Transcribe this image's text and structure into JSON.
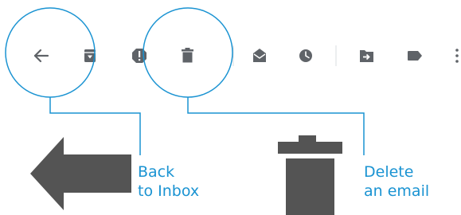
{
  "colors": {
    "icon": "#5f6368",
    "big_icon": "#545454",
    "accent": "#1a93d2",
    "divider": "#dadce0",
    "background": "#ffffff"
  },
  "toolbar": {
    "buttons": [
      {
        "name": "back-button",
        "icon": "arrow-left-icon"
      },
      {
        "name": "archive-button",
        "icon": "archive-icon"
      },
      {
        "name": "report-spam-button",
        "icon": "report-spam-icon"
      },
      {
        "name": "delete-button",
        "icon": "trash-icon"
      },
      {
        "name": "mark-as-unread-button",
        "icon": "mark-unread-icon"
      },
      {
        "name": "snooze-button",
        "icon": "clock-icon"
      },
      {
        "name": "move-to-button",
        "icon": "move-to-folder-icon"
      },
      {
        "name": "labels-button",
        "icon": "label-icon"
      },
      {
        "name": "more-options-button",
        "icon": "more-vert-icon"
      }
    ]
  },
  "callouts": {
    "back": {
      "line1": "Back",
      "line2": "to Inbox",
      "icon": "arrow-left-icon"
    },
    "delete": {
      "line1": "Delete",
      "line2": "an email",
      "icon": "trash-icon"
    }
  }
}
